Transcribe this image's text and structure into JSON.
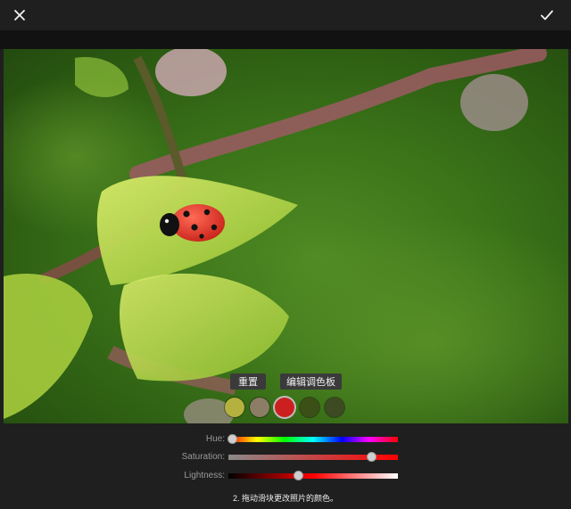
{
  "toolbar": {
    "close_icon": "close-icon",
    "confirm_icon": "check-icon"
  },
  "photo": {
    "subject": "ladybug-on-leaf-image"
  },
  "palette": {
    "reset_label": "重置",
    "edit_label": "编辑调色板",
    "swatches": [
      {
        "color": "#b5b13f",
        "selected": false
      },
      {
        "color": "#8c7d66",
        "selected": false
      },
      {
        "color": "#cc1f1f",
        "selected": true
      },
      {
        "color": "#3c4f17",
        "selected": false
      },
      {
        "color": "#3d4a22",
        "selected": false
      }
    ]
  },
  "sliders": {
    "hue": {
      "label": "Hue:",
      "value": 0.02
    },
    "saturation": {
      "label": "Saturation:",
      "value": 0.84
    },
    "lightness": {
      "label": "Lightness:",
      "value": 0.41
    }
  },
  "hint": "2. 拖动滑块更改照片的颜色。"
}
